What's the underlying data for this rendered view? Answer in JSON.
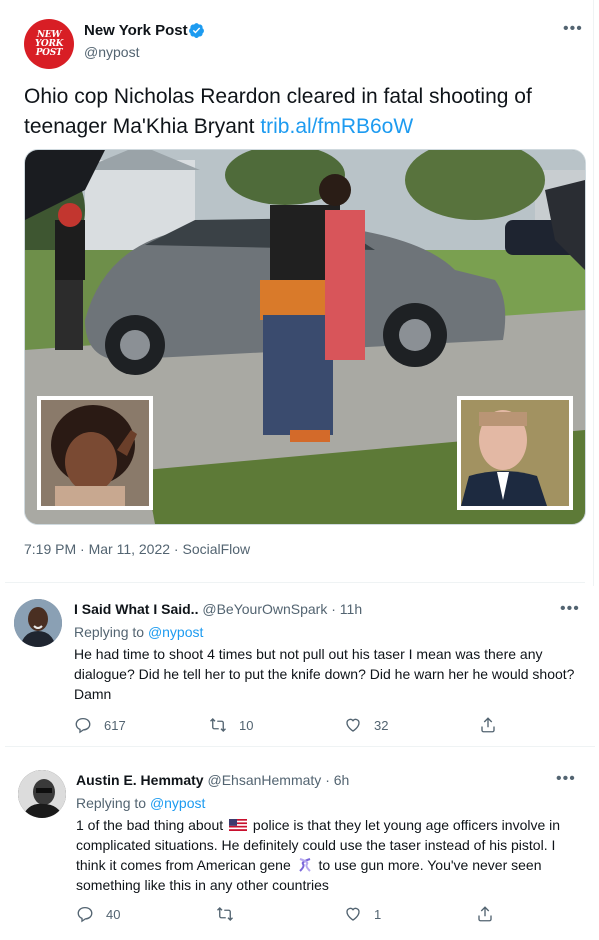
{
  "main_tweet": {
    "author": {
      "avatar_text": [
        "NEW",
        "YORK",
        "POST"
      ],
      "name": "New York Post",
      "handle": "@nypost",
      "verified": true
    },
    "more_icon": "more-horizontal-icon",
    "text": "Ohio cop Nicholas Reardon cleared in fatal shooting of teenager Ma'Khia Bryant ",
    "link": "trib.al/fmRB6oW",
    "timestamp": "7:19 PM · Mar 11, 2022 · SocialFlow"
  },
  "replies": [
    {
      "name": "I Said What I Said..",
      "handle": "@BeYourOwnSpark",
      "time": "11h",
      "replying_label": "Replying to",
      "replying_to": "@nypost",
      "text": "He had time to shoot 4 times but not pull out his taser I mean was there any dialogue? Did he tell her to put the knife down? Did he warn her he would shoot? Damn",
      "reply_count": "617",
      "retweet_count": "10",
      "like_count": "32"
    },
    {
      "name": "Austin E. Hemmaty",
      "handle": "@EhsanHemmaty",
      "time": "6h",
      "replying_label": "Replying to",
      "replying_to": "@nypost",
      "text_part1": "1 of the bad thing about ",
      "text_part2": " police is that they let young age officers involve in complicated situations. He definitely could use the taser instead of his pistol. I think it comes from American gene ",
      "text_part3": " to use gun more. You've never seen something like this in any other countries",
      "reply_count": "40",
      "retweet_count": "",
      "like_count": "1"
    }
  ],
  "icons": {
    "reply": "reply-bubble-icon",
    "retweet": "retweet-icon",
    "like": "heart-icon",
    "share": "share-icon",
    "flag": "us-flag-emoji-icon",
    "dna": "dna-emoji-icon"
  },
  "colors": {
    "accent": "#1d9bf0",
    "text": "#0f1419",
    "secondary": "#536471",
    "brand_red": "#d81e25"
  }
}
